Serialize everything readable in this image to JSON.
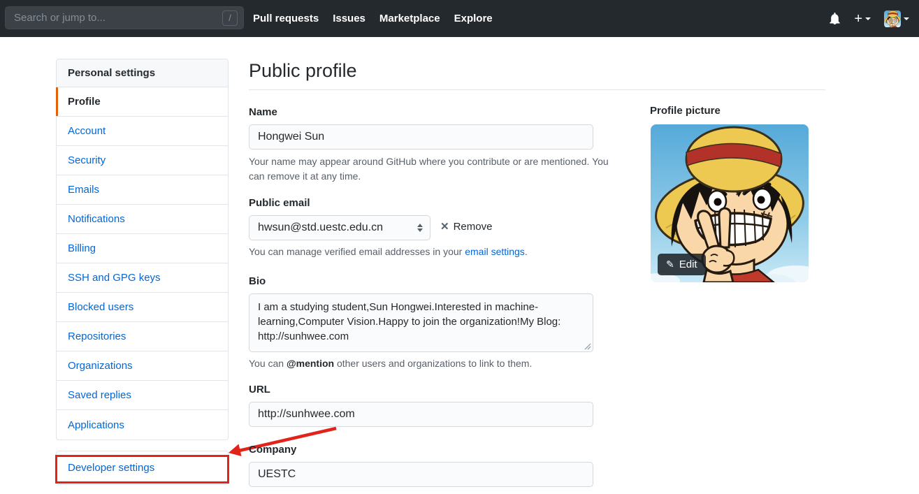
{
  "header": {
    "search": {
      "placeholder": "Search or jump to...",
      "shortcut_key": "/"
    },
    "nav": [
      "Pull requests",
      "Issues",
      "Marketplace",
      "Explore"
    ],
    "plus_label": "+"
  },
  "sidebar": {
    "title": "Personal settings",
    "items": [
      {
        "label": "Profile",
        "active": true
      },
      {
        "label": "Account"
      },
      {
        "label": "Security"
      },
      {
        "label": "Emails"
      },
      {
        "label": "Notifications"
      },
      {
        "label": "Billing"
      },
      {
        "label": "SSH and GPG keys"
      },
      {
        "label": "Blocked users"
      },
      {
        "label": "Repositories"
      },
      {
        "label": "Organizations"
      },
      {
        "label": "Saved replies"
      },
      {
        "label": "Applications"
      }
    ],
    "developer_settings_label": "Developer settings"
  },
  "main": {
    "title": "Public profile",
    "name": {
      "label": "Name",
      "value": "Hongwei Sun",
      "help": "Your name may appear around GitHub where you contribute or are mentioned. You can remove it at any time."
    },
    "public_email": {
      "label": "Public email",
      "selected": "hwsun@std.uestc.edu.cn",
      "remove_label": "Remove",
      "help_prefix": "You can manage verified email addresses in your ",
      "help_link_text": "email settings",
      "help_suffix": "."
    },
    "bio": {
      "label": "Bio",
      "value": "I am a studying student,Sun Hongwei.Interested in machine-learning,Computer Vision.Happy to join the organization!My Blog: http://sunhwee.com",
      "help_prefix": "You can ",
      "help_mention": "@mention",
      "help_suffix": " other users and organizations to link to them."
    },
    "url": {
      "label": "URL",
      "value": "http://sunhwee.com"
    },
    "company": {
      "label": "Company",
      "value": "UESTC"
    }
  },
  "profile_picture": {
    "label": "Profile picture",
    "edit_label": "Edit"
  },
  "colors": {
    "header_bg": "#24292e",
    "link_blue": "#0366d6",
    "active_item_accent": "#e36209",
    "annotation_red": "#e2231a",
    "muted_text": "#586069",
    "border": "#e1e4e8",
    "input_bg": "#fafbfc"
  }
}
